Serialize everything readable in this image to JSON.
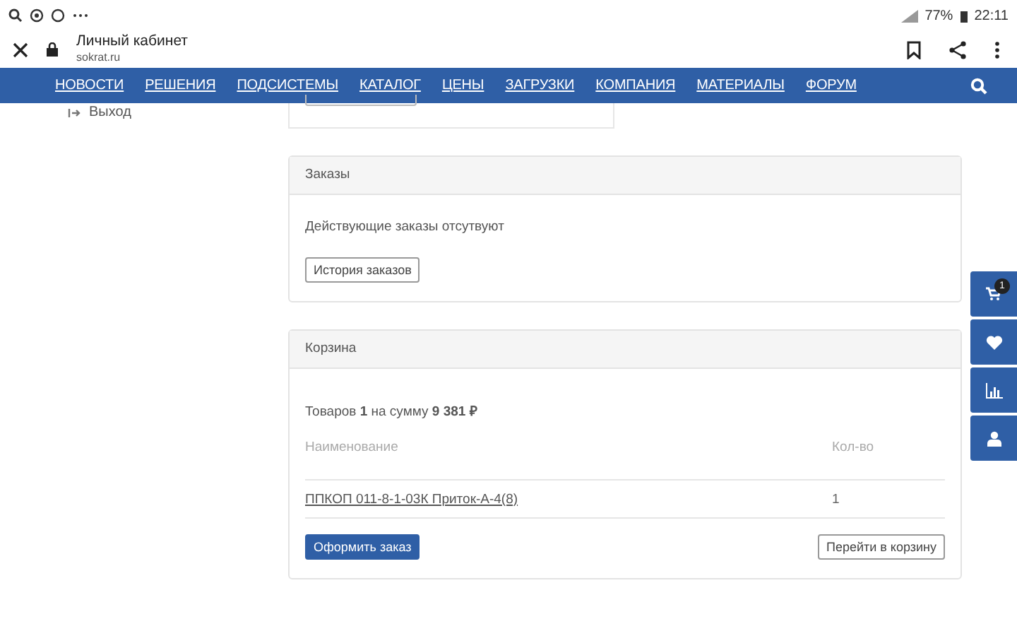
{
  "status_bar": {
    "battery": "77%",
    "time": "22:11"
  },
  "browser": {
    "title": "Личный кабинет",
    "url": "sokrat.ru"
  },
  "nav": {
    "items": [
      "НОВОСТИ",
      "РЕШЕНИЯ",
      "ПОДСИСТЕМЫ",
      "КАТАЛОГ",
      "ЦЕНЫ",
      "ЗАГРУЗКИ",
      "КОМПАНИЯ",
      "МАТЕРИАЛЫ",
      "ФОРУМ"
    ]
  },
  "sidebar": {
    "items": [
      {
        "label": "Выход"
      }
    ]
  },
  "orders": {
    "title": "Заказы",
    "message": "Действующие заказы отсутвуют",
    "button": "История заказов"
  },
  "cart": {
    "title": "Корзина",
    "summary": "Товаров **1** на сумму **9 381 ₽**",
    "columns": [
      "Наименование",
      "Кол-во"
    ],
    "rows": [
      {
        "name": "ППКОП 011-8-1-03К Приток-А-4(8)",
        "qty": "1"
      }
    ],
    "checkout_button": "Оформить заказ",
    "cart_button": "Перейти в корзину"
  },
  "floating": [
    {
      "kind": "cart",
      "badge": "1"
    },
    {
      "kind": "favorite"
    },
    {
      "kind": "compare"
    },
    {
      "kind": "profile"
    }
  ]
}
